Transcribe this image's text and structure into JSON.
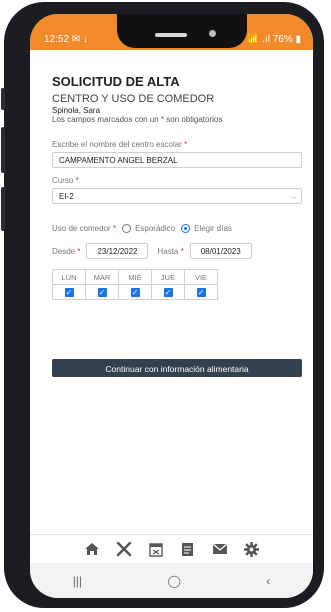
{
  "status": {
    "time": "12:52 ✉ ↓",
    "right": "📶 .ıl 76% ▮"
  },
  "form": {
    "title": "SOLICITUD DE ALTA",
    "subtitle": "CENTRO Y USO DE COMEDOR",
    "user": "Spinola, Sara",
    "required_note_pre": "Los campos marcados con un ",
    "required_note_star": "*",
    "required_note_post": " son obligatorios",
    "school_label": "Escribe el nombre del centro escolar",
    "school_value": "CAMPAMENTO ANGEL BERZAL",
    "course_label": "Curso",
    "course_value": "EI-2",
    "dining_label": "Uso de comedor",
    "opt_sporadic": "Esporádico",
    "opt_choose": "Elegir días",
    "selected_option": "Elegir días",
    "from_label": "Desde",
    "from_value": "23/12/2022",
    "to_label": "Hasta",
    "to_value": "08/01/2023",
    "days": [
      "LUN",
      "MAR",
      "MIÉ",
      "JUE",
      "VIE"
    ],
    "days_checked": [
      true,
      true,
      true,
      true,
      true
    ],
    "continue_button": "Continuar con información alimentaria",
    "required_star": "*"
  },
  "colors": {
    "header": "#f08a2a",
    "accent": "#1a73e8",
    "button": "#33404e",
    "required": "#e0283b"
  },
  "toolbar_icons": [
    "home-icon",
    "tools-icon",
    "calendar-icon",
    "document-icon",
    "mail-icon",
    "gear-icon"
  ],
  "nav": {
    "recent": "|||",
    "home": "◯",
    "back": "‹"
  }
}
